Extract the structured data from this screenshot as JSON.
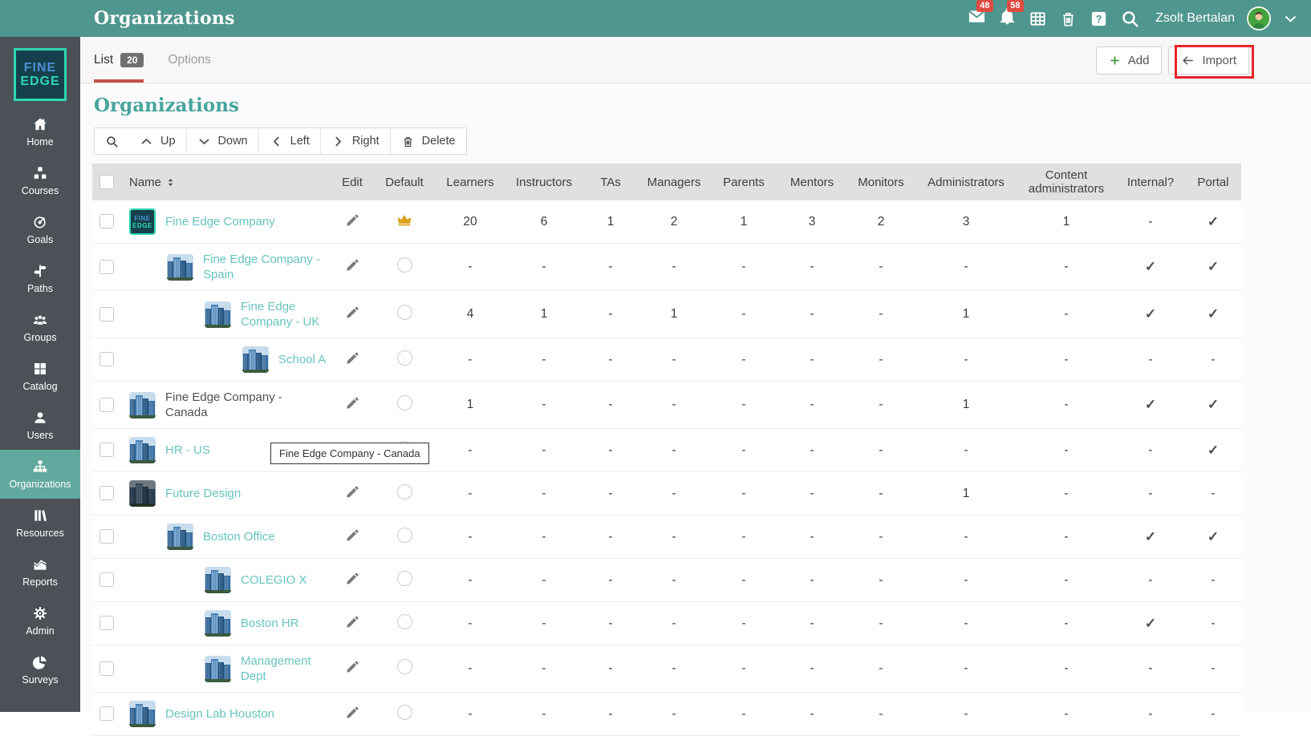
{
  "topbar": {
    "title": "Organizations",
    "mail_badge": "48",
    "notifications_badge": "58",
    "user_name": "Zsolt Bertalan"
  },
  "sidebar": {
    "logo_top": "FINE",
    "logo_bottom": "EDGE",
    "items": [
      {
        "label": "Home",
        "icon": "home",
        "active": false
      },
      {
        "label": "Courses",
        "icon": "courses",
        "active": false
      },
      {
        "label": "Goals",
        "icon": "goals",
        "active": false
      },
      {
        "label": "Paths",
        "icon": "paths",
        "active": false
      },
      {
        "label": "Groups",
        "icon": "groups",
        "active": false
      },
      {
        "label": "Catalog",
        "icon": "catalog",
        "active": false
      },
      {
        "label": "Users",
        "icon": "users",
        "active": false
      },
      {
        "label": "Organizations",
        "icon": "organizations",
        "active": true
      },
      {
        "label": "Resources",
        "icon": "resources",
        "active": false
      },
      {
        "label": "Reports",
        "icon": "reports",
        "active": false
      },
      {
        "label": "Admin",
        "icon": "admin",
        "active": false
      },
      {
        "label": "Surveys",
        "icon": "surveys",
        "active": false
      }
    ]
  },
  "tabs": {
    "list_label": "List",
    "list_count": "20",
    "options_label": "Options"
  },
  "actions": {
    "add_label": "Add",
    "import_label": "Import"
  },
  "page_heading": "Organizations",
  "toolbar": {
    "buttons": [
      {
        "label": "Up",
        "icon": "chevron-up"
      },
      {
        "label": "Down",
        "icon": "chevron-down"
      },
      {
        "label": "Left",
        "icon": "chevron-left"
      },
      {
        "label": "Right",
        "icon": "chevron-right"
      },
      {
        "label": "Delete",
        "icon": "trash"
      }
    ]
  },
  "tooltip_text": "Fine Edge Company - Canada",
  "table": {
    "columns": [
      "",
      "Name",
      "Edit",
      "Default",
      "Learners",
      "Instructors",
      "TAs",
      "Managers",
      "Parents",
      "Mentors",
      "Monitors",
      "Administrators",
      "Content administrators",
      "Internal?",
      "Portal"
    ],
    "rows": [
      {
        "name": "Fine Edge Company",
        "level": 0,
        "thumb": "logo",
        "name_style": "link",
        "default": "crown",
        "values": [
          "20",
          "6",
          "1",
          "2",
          "1",
          "3",
          "2",
          "3",
          "1",
          "-",
          "✓"
        ]
      },
      {
        "name": "Fine Edge Company - Spain",
        "level": 1,
        "thumb": "building",
        "name_style": "link",
        "default": "radio",
        "values": [
          "-",
          "-",
          "-",
          "-",
          "-",
          "-",
          "-",
          "-",
          "-",
          "✓",
          "✓"
        ]
      },
      {
        "name": "Fine Edge Company - UK",
        "level": 2,
        "thumb": "building",
        "name_style": "link",
        "default": "radio",
        "values": [
          "4",
          "1",
          "-",
          "1",
          "-",
          "-",
          "-",
          "1",
          "-",
          "✓",
          "✓"
        ]
      },
      {
        "name": "School A",
        "level": 3,
        "thumb": "building",
        "name_style": "link",
        "default": "radio",
        "values": [
          "-",
          "-",
          "-",
          "-",
          "-",
          "-",
          "-",
          "-",
          "-",
          "-",
          "-"
        ]
      },
      {
        "name": "Fine Edge Company - Canada",
        "level": 0,
        "thumb": "building",
        "name_style": "dark",
        "default": "radio",
        "values": [
          "1",
          "-",
          "-",
          "-",
          "-",
          "-",
          "-",
          "1",
          "-",
          "✓",
          "✓"
        ]
      },
      {
        "name": "HR - US",
        "level": 0,
        "thumb": "building",
        "name_style": "link",
        "default": "radio",
        "values": [
          "-",
          "-",
          "-",
          "-",
          "-",
          "-",
          "-",
          "-",
          "-",
          "-",
          "✓"
        ]
      },
      {
        "name": "Future Design",
        "level": 0,
        "thumb": "building-dark",
        "name_style": "link",
        "default": "radio",
        "values": [
          "-",
          "-",
          "-",
          "-",
          "-",
          "-",
          "-",
          "1",
          "-",
          "-",
          "-"
        ]
      },
      {
        "name": "Boston Office",
        "level": 1,
        "thumb": "building",
        "name_style": "link",
        "default": "radio",
        "values": [
          "-",
          "-",
          "-",
          "-",
          "-",
          "-",
          "-",
          "-",
          "-",
          "✓",
          "✓"
        ]
      },
      {
        "name": "COLEGIO X",
        "level": 2,
        "thumb": "building",
        "name_style": "link",
        "default": "radio",
        "values": [
          "-",
          "-",
          "-",
          "-",
          "-",
          "-",
          "-",
          "-",
          "-",
          "-",
          "-"
        ]
      },
      {
        "name": "Boston HR",
        "level": 2,
        "thumb": "building",
        "name_style": "link",
        "default": "radio",
        "values": [
          "-",
          "-",
          "-",
          "-",
          "-",
          "-",
          "-",
          "-",
          "-",
          "✓",
          "-"
        ]
      },
      {
        "name": "Management Dept",
        "level": 2,
        "thumb": "building",
        "name_style": "link",
        "default": "radio",
        "values": [
          "-",
          "-",
          "-",
          "-",
          "-",
          "-",
          "-",
          "-",
          "-",
          "-",
          "-"
        ]
      },
      {
        "name": "Design Lab Houston",
        "level": 0,
        "thumb": "building",
        "name_style": "link",
        "default": "radio",
        "values": [
          "-",
          "-",
          "-",
          "-",
          "-",
          "-",
          "-",
          "-",
          "-",
          "-",
          "-"
        ]
      }
    ]
  },
  "colors": {
    "header_teal": "#4f968e",
    "sidebar_dark": "#4b5156",
    "active_item_teal": "#61a89e",
    "link_teal": "#68c4c0",
    "heading_teal": "#47a59d",
    "badge_red": "#e04a41",
    "tab_underline_red": "#c5514c",
    "highlight_red": "#e8252a",
    "add_green": "#3f9c3b",
    "crown_gold": "#d9a21a",
    "logo_blue": "#4b8fd5",
    "logo_teal": "#2fd7b2"
  }
}
